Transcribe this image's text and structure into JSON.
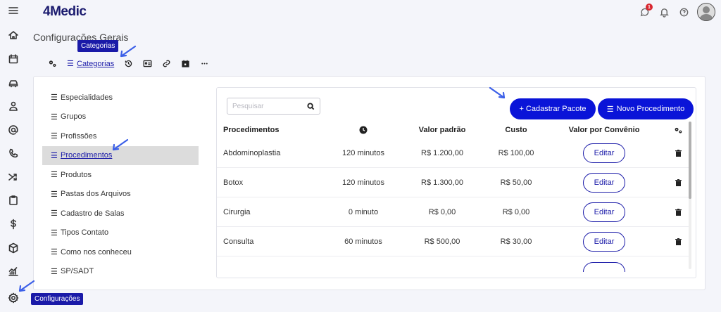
{
  "app": {
    "logo_four": "4",
    "logo_rest": "Medic"
  },
  "header": {
    "notification_count": "1"
  },
  "page_title": "Configurações Gerais",
  "tooltips": {
    "categorias": "Categorias",
    "configuracoes": "Configurações"
  },
  "tabs": [
    {
      "label": "Categorias"
    }
  ],
  "left_menu": [
    {
      "label": "Especialidades"
    },
    {
      "label": "Grupos"
    },
    {
      "label": "Profissões"
    },
    {
      "label": "Procedimentos"
    },
    {
      "label": "Produtos"
    },
    {
      "label": "Pastas dos Arquivos"
    },
    {
      "label": "Cadastro de Salas"
    },
    {
      "label": "Tipos Contato"
    },
    {
      "label": "Como nos conheceu"
    },
    {
      "label": "SP/SADT"
    }
  ],
  "search": {
    "placeholder": "Pesquisar"
  },
  "buttons": {
    "cadastrar_pacote": "+ Cadastrar Pacote",
    "novo_procedimento": "Novo Procedimento"
  },
  "table": {
    "headers": {
      "procedimentos": "Procedimentos",
      "valor_padrao": "Valor padrão",
      "custo": "Custo",
      "valor_convenio": "Valor por Convênio"
    },
    "edit_label": "Editar",
    "rows": [
      {
        "name": "Abdominoplastia",
        "duration": "120 minutos",
        "valor": "R$ 1.200,00",
        "custo": "R$ 100,00"
      },
      {
        "name": "Botox",
        "duration": "120 minutos",
        "valor": "R$ 1.300,00",
        "custo": "R$ 50,00"
      },
      {
        "name": "Cirurgia",
        "duration": "0 minuto",
        "valor": "R$ 0,00",
        "custo": "R$ 0,00"
      },
      {
        "name": "Consulta",
        "duration": "60 minutos",
        "valor": "R$ 500,00",
        "custo": "R$ 30,00"
      }
    ]
  },
  "colors": {
    "accent": "#0a14d8",
    "tooltip": "#1a1aa8",
    "badge": "#d8262f"
  }
}
